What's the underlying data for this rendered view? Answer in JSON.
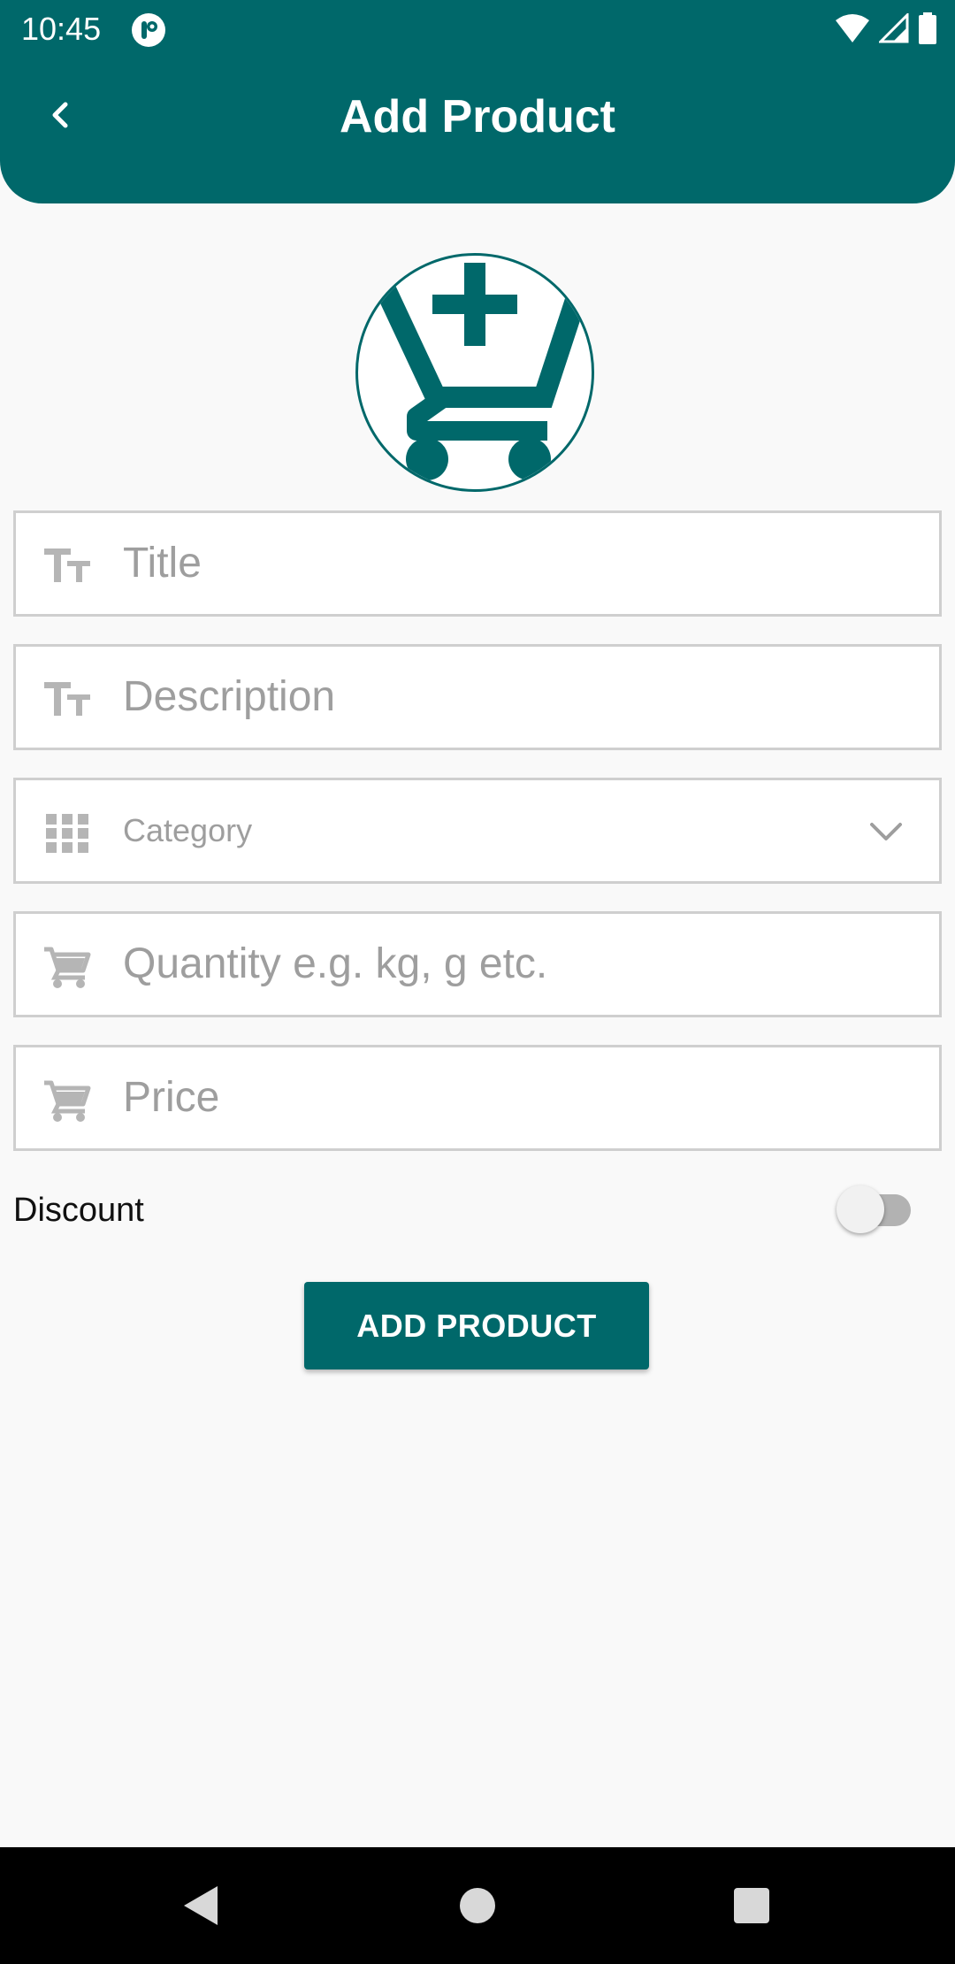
{
  "status_bar": {
    "time": "10:45",
    "icons": [
      "app-notification-icon",
      "wifi-icon",
      "cellular-signal-icon",
      "battery-icon"
    ]
  },
  "header": {
    "title": "Add Product",
    "back_icon": "chevron-left-icon"
  },
  "product_image": {
    "icon": "cart-plus-icon"
  },
  "form": {
    "title_field": {
      "placeholder": "Title",
      "icon": "text-size-icon"
    },
    "description_field": {
      "placeholder": "Description",
      "icon": "text-size-icon"
    },
    "category_field": {
      "placeholder": "Category",
      "icon": "grid-icon",
      "dropdown_icon": "chevron-down-icon"
    },
    "quantity_field": {
      "placeholder": "Quantity e.g. kg, g etc.",
      "icon": "cart-icon"
    },
    "price_field": {
      "placeholder": "Price",
      "icon": "cart-icon"
    },
    "discount": {
      "label": "Discount",
      "enabled": false
    },
    "submit_label": "ADD PRODUCT"
  },
  "nav_bar": {
    "buttons": [
      "back-triangle-icon",
      "home-circle-icon",
      "recents-square-icon"
    ]
  },
  "colors": {
    "primary": "#00686a",
    "background": "#f9f9f9",
    "field_border": "#cfcfcf",
    "placeholder": "#9e9e9e",
    "icon_gray": "#b5b5b5"
  }
}
